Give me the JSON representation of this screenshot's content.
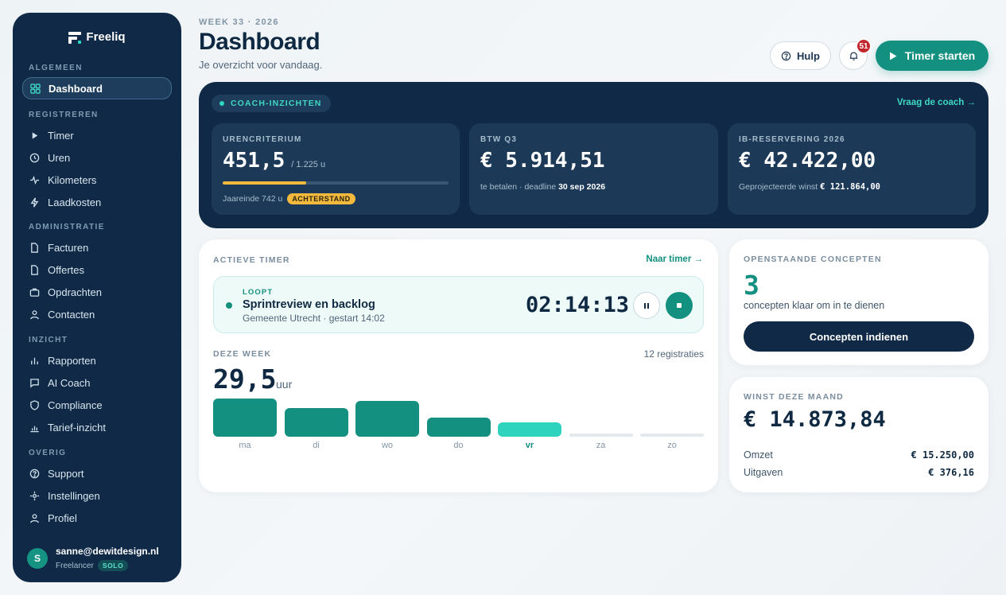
{
  "brand": {
    "name": "Freeliq"
  },
  "sidebar": {
    "sections": [
      {
        "label": "ALGEMEEN"
      },
      {
        "label": "REGISTREREN"
      },
      {
        "label": "ADMINISTRATIE"
      },
      {
        "label": "INZICHT"
      },
      {
        "label": "OVERIG"
      }
    ],
    "items": [
      {
        "label": "Dashboard",
        "icon": "grid-icon",
        "active": true
      },
      {
        "label": "Timer",
        "icon": "play-icon"
      },
      {
        "label": "Uren",
        "icon": "clock-icon"
      },
      {
        "label": "Kilometers",
        "icon": "activity-icon"
      },
      {
        "label": "Laadkosten",
        "icon": "bolt-icon"
      },
      {
        "label": "Facturen",
        "icon": "file-icon"
      },
      {
        "label": "Offertes",
        "icon": "file-icon"
      },
      {
        "label": "Opdrachten",
        "icon": "briefcase-icon"
      },
      {
        "label": "Contacten",
        "icon": "user-icon"
      },
      {
        "label": "Rapporten",
        "icon": "bar-chart-icon"
      },
      {
        "label": "AI Coach",
        "icon": "chat-icon"
      },
      {
        "label": "Compliance",
        "icon": "shield-icon"
      },
      {
        "label": "Tarief-inzicht",
        "icon": "chart-icon"
      },
      {
        "label": "Support",
        "icon": "help-icon"
      },
      {
        "label": "Instellingen",
        "icon": "settings-icon"
      },
      {
        "label": "Profiel",
        "icon": "user-icon"
      }
    ],
    "user": {
      "initial": "S",
      "email": "sanne@dewitdesign.nl",
      "role": "Freelancer",
      "plan": "SOLO"
    }
  },
  "header": {
    "week": "WEEK 33 · 2026",
    "title": "Dashboard",
    "subtitle": "Je overzicht voor vandaag.",
    "help_label": "Hulp",
    "notifications": "51",
    "timer_label": "Timer starten"
  },
  "coach": {
    "pill": "COACH-INZICHTEN",
    "link": "Vraag de coach →",
    "hours": {
      "label": "URENCRITERIUM",
      "value": "451,5",
      "target": "/ 1.225 u",
      "progress": 0.369,
      "year_end": "Jaareinde 742 u",
      "status": "ACHTERSTAND"
    },
    "vat": {
      "label": "BTW Q3",
      "value": "€ 5.914,51",
      "note": "te betalen · deadline",
      "deadline": "30 sep 2026"
    },
    "ib": {
      "label": "IB-RESERVERING 2026",
      "value": "€ 42.422,00",
      "note": "Geprojecteerde winst",
      "profit": "€ 121.864,00"
    }
  },
  "active_timer": {
    "label": "ACTIEVE TIMER",
    "link": "Naar timer →",
    "status": "LOOPT",
    "task": "Sprintreview en backlog",
    "meta": "Gemeente Utrecht · gestart 14:02",
    "elapsed": "02:14:13"
  },
  "week": {
    "label": "DEZE WEEK",
    "registrations": "12 registraties",
    "total": "29,5",
    "unit": "uur",
    "days": [
      {
        "label": "ma",
        "hours": 8
      },
      {
        "label": "di",
        "hours": 6
      },
      {
        "label": "wo",
        "hours": 7.5
      },
      {
        "label": "do",
        "hours": 4
      },
      {
        "label": "vr",
        "hours": 3,
        "today": true
      },
      {
        "label": "za",
        "hours": 0
      },
      {
        "label": "zo",
        "hours": 0
      }
    ]
  },
  "concepts": {
    "label": "OPENSTAANDE CONCEPTEN",
    "count": "3",
    "text": "concepten klaar om in te dienen",
    "button": "Concepten indienen"
  },
  "profit": {
    "label": "WINST DEZE MAAND",
    "value": "€ 14.873,84",
    "revenue_label": "Omzet",
    "revenue": "€ 15.250,00",
    "expenses_label": "Uitgaven",
    "expenses": "€ 376,16"
  },
  "colors": {
    "navy": "#0f2947",
    "teal": "#13907f",
    "teal_light": "#2dd3bd",
    "warning": "#f2b93d",
    "badge": "#c1272d"
  }
}
